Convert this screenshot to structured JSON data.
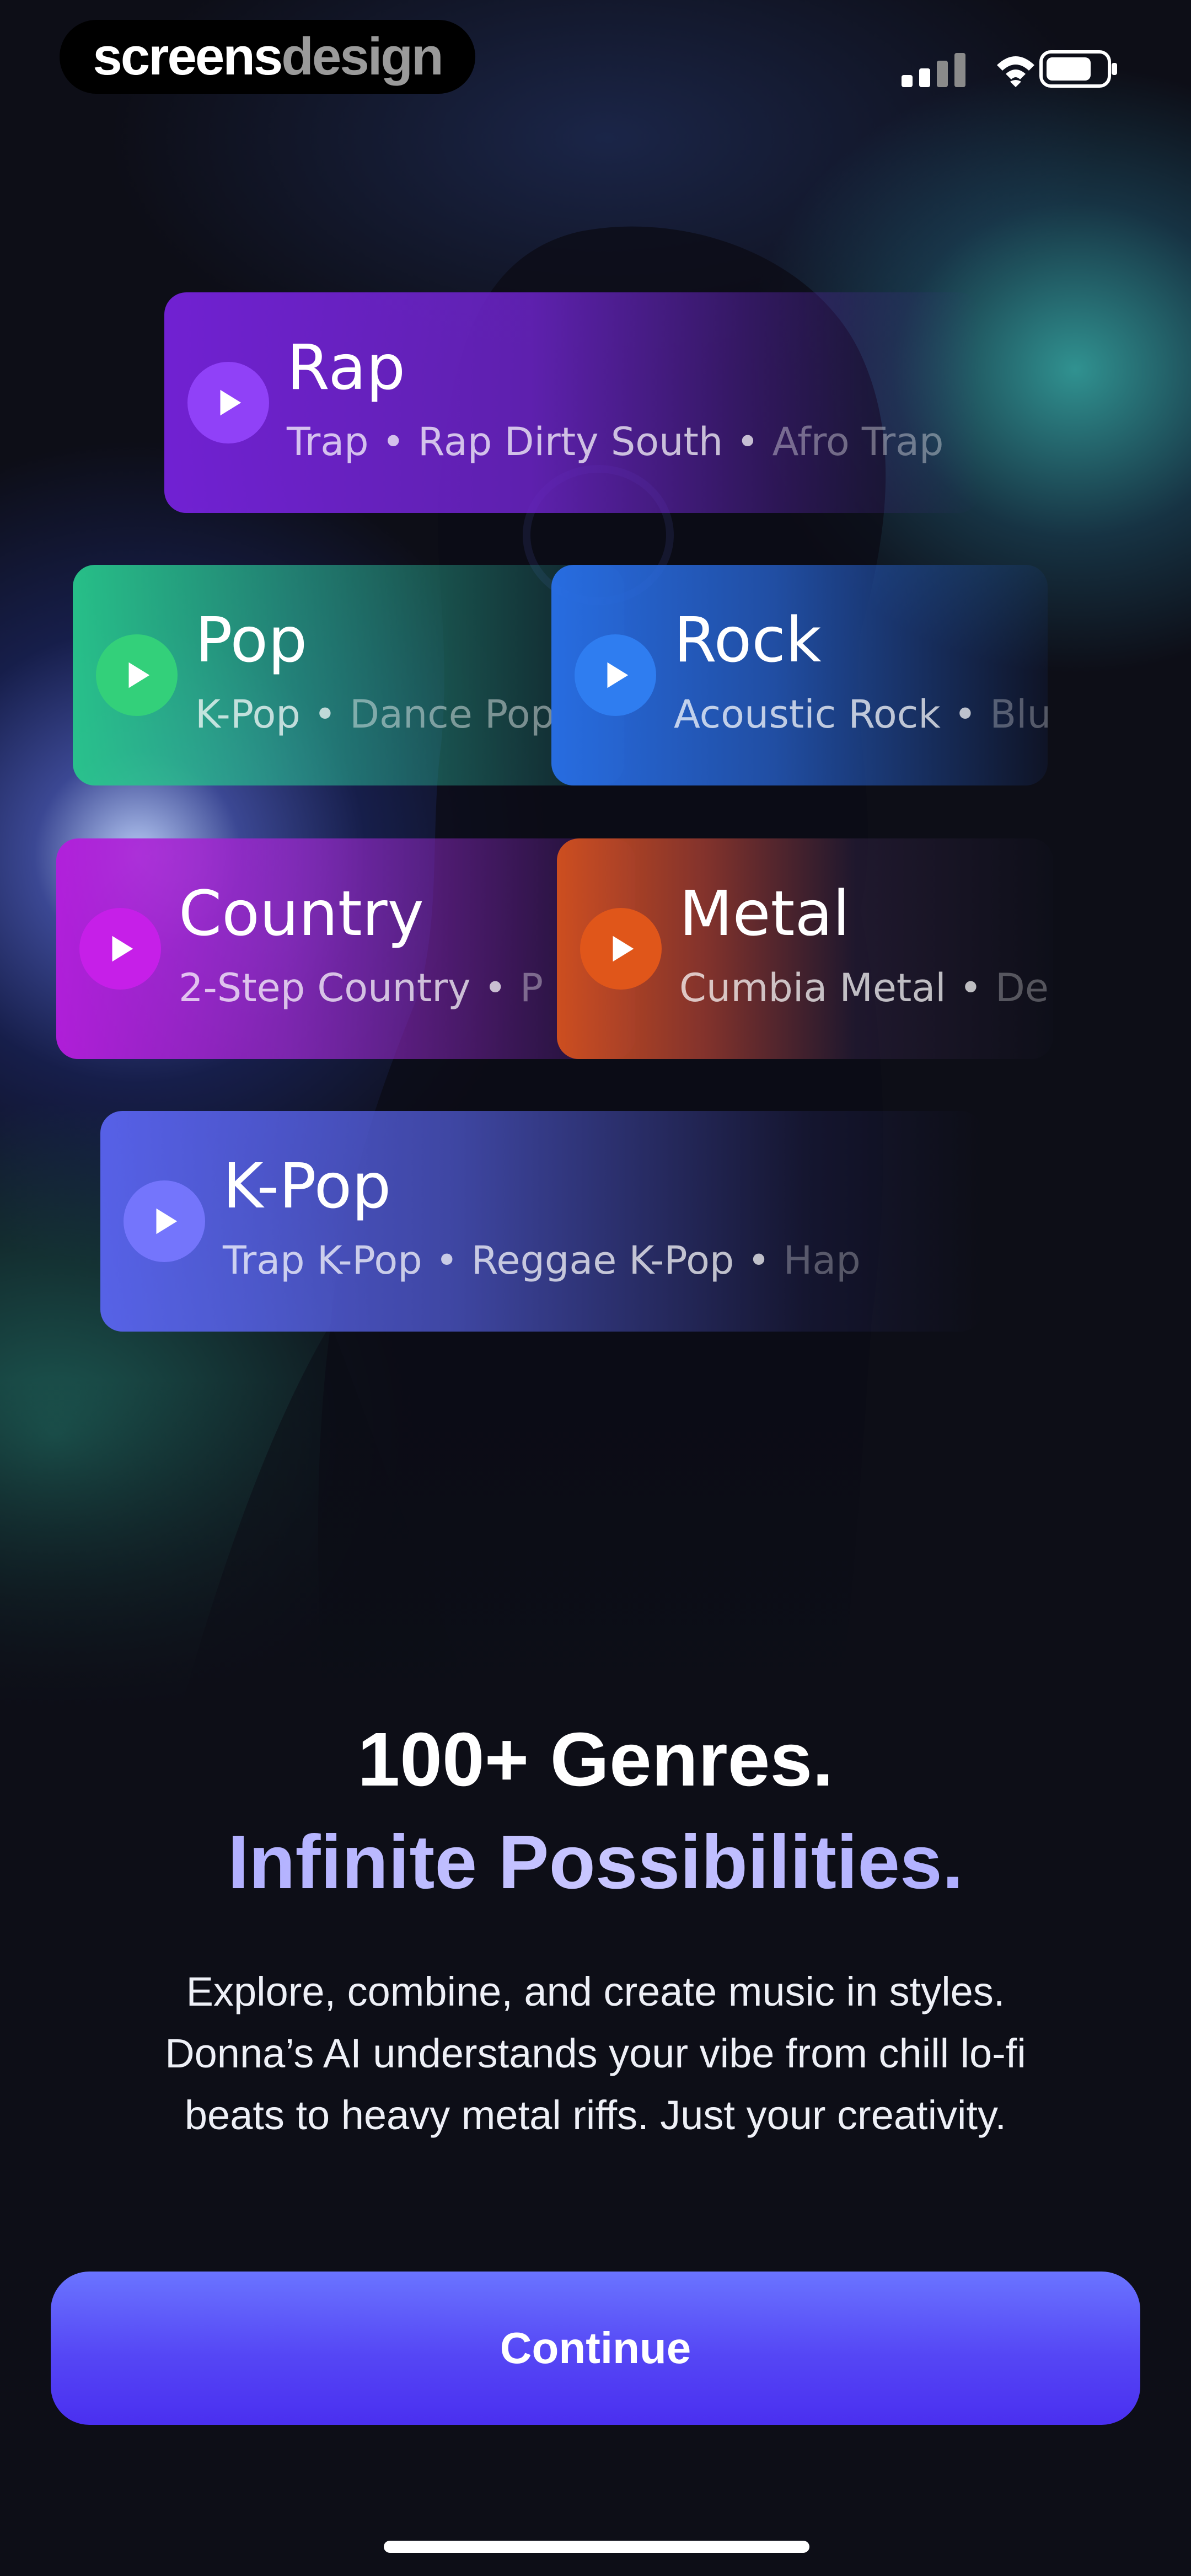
{
  "watermark": {
    "part1": "screens",
    "part2": "design"
  },
  "status_bar": {
    "icons": [
      "signal-icon",
      "wifi-icon",
      "battery-icon"
    ]
  },
  "genres": [
    {
      "title": "Rap",
      "subgenres": [
        "Trap",
        "Rap Dirty South",
        "Afro Trap"
      ]
    },
    {
      "title": "Pop",
      "subgenres": [
        "K-Pop",
        "Dance Pop"
      ]
    },
    {
      "title": "Rock",
      "subgenres": [
        "Acoustic Rock",
        "Blu"
      ]
    },
    {
      "title": "Country",
      "subgenres": [
        "2-Step Country",
        "P"
      ]
    },
    {
      "title": "Metal",
      "subgenres": [
        "Cumbia Metal",
        "De"
      ]
    },
    {
      "title": "K-Pop",
      "subgenres": [
        "Trap K-Pop",
        "Reggae K-Pop",
        "Hap"
      ]
    }
  ],
  "headline": "100+ Genres.",
  "headline_accent": "Infinite Possibilities.",
  "description_lines": [
    "Explore, combine, and create music in styles.",
    "Donna’s AI understands your vibe from chill lo-fi",
    "beats to heavy metal riffs. Just your creativity."
  ],
  "continue_label": "Continue",
  "colors": {
    "background": "#0d0e17",
    "accent": "#5546f5",
    "rap": "#7622dc",
    "pop": "#28c88c",
    "rock": "#286ee6",
    "country": "#b41edc",
    "metal": "#d2501e",
    "kpop": "#5a64f0"
  }
}
